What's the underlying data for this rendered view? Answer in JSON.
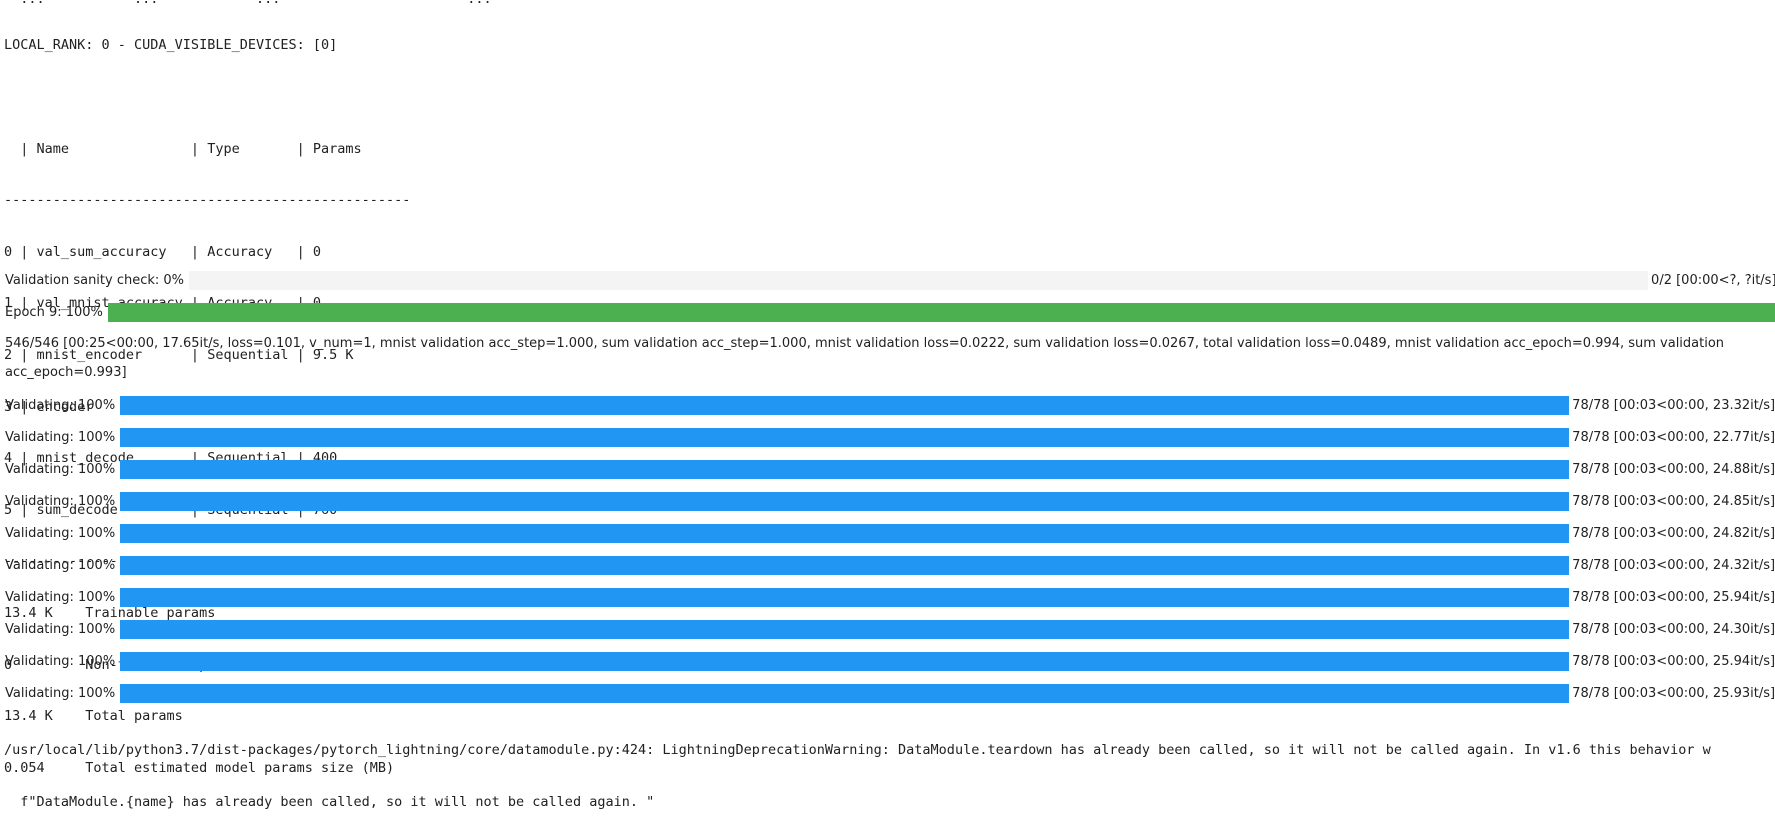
{
  "output": {
    "cut_top_line": "  ...           ...            ...                       ...",
    "local_rank_line": "LOCAL_RANK: 0 - CUDA_VISIBLE_DEVICES: [0]",
    "summary_header": "  | Name               | Type       | Params",
    "separator": "--------------------------------------------------",
    "summary_rows": [
      "0 | val_sum_accuracy   | Accuracy   | 0",
      "1 | val_mnist_accuracy | Accuracy   | 0",
      "2 | mnist_encoder      | Sequential | 9.5 K",
      "3 | encoder            | Sequential | 2.8 K",
      "4 | mnist_decode       | Sequential | 400",
      "5 | sum_decode         | Sequential | 760"
    ],
    "param_totals": [
      "13.4 K    Trainable params",
      "0         Non-trainable params",
      "13.4 K    Total params",
      "0.054     Total estimated model params size (MB)"
    ]
  },
  "sanity_bar": {
    "label": "Validation sanity check: 0%",
    "fraction": 0,
    "postfix": "0/2 [00:00<?, ?it/s]"
  },
  "epoch_bar": {
    "label": "Epoch 9: 100%",
    "fraction": 1.0,
    "color": "#4caf50",
    "postfix": "546/546 [00:25<00:00, 17.65it/s, loss=0.101, v_num=1, mnist validation acc_step=1.000, sum validation acc_step=1.000, mnist validation loss=0.0222, sum validation loss=0.0267, total validation loss=0.0489, mnist validation acc_epoch=0.994, sum validation acc_epoch=0.993]"
  },
  "validation_bars": {
    "color": "#2196f3",
    "items": [
      {
        "label": "Validating: 100%",
        "fraction": 1.0,
        "postfix": "78/78 [00:03<00:00, 23.32it/s]"
      },
      {
        "label": "Validating: 100%",
        "fraction": 1.0,
        "postfix": "78/78 [00:03<00:00, 22.77it/s]"
      },
      {
        "label": "Validating: 100%",
        "fraction": 1.0,
        "postfix": "78/78 [00:03<00:00, 24.88it/s]"
      },
      {
        "label": "Validating: 100%",
        "fraction": 1.0,
        "postfix": "78/78 [00:03<00:00, 24.85it/s]"
      },
      {
        "label": "Validating: 100%",
        "fraction": 1.0,
        "postfix": "78/78 [00:03<00:00, 24.82it/s]"
      },
      {
        "label": "Validating: 100%",
        "fraction": 1.0,
        "postfix": "78/78 [00:03<00:00, 24.32it/s]"
      },
      {
        "label": "Validating: 100%",
        "fraction": 1.0,
        "postfix": "78/78 [00:03<00:00, 25.94it/s]"
      },
      {
        "label": "Validating: 100%",
        "fraction": 1.0,
        "postfix": "78/78 [00:03<00:00, 24.30it/s]"
      },
      {
        "label": "Validating: 100%",
        "fraction": 1.0,
        "postfix": "78/78 [00:03<00:00, 25.94it/s]"
      },
      {
        "label": "Validating: 100%",
        "fraction": 1.0,
        "postfix": "78/78 [00:03<00:00, 25.93it/s]"
      }
    ]
  },
  "warning": {
    "line1": "/usr/local/lib/python3.7/dist-packages/pytorch_lightning/core/datamodule.py:424: LightningDeprecationWarning: DataModule.teardown has already been called, so it will not be called again. In v1.6 this behavior w",
    "line2": "  f\"DataModule.{name} has already been called, so it will not be called again. \""
  }
}
